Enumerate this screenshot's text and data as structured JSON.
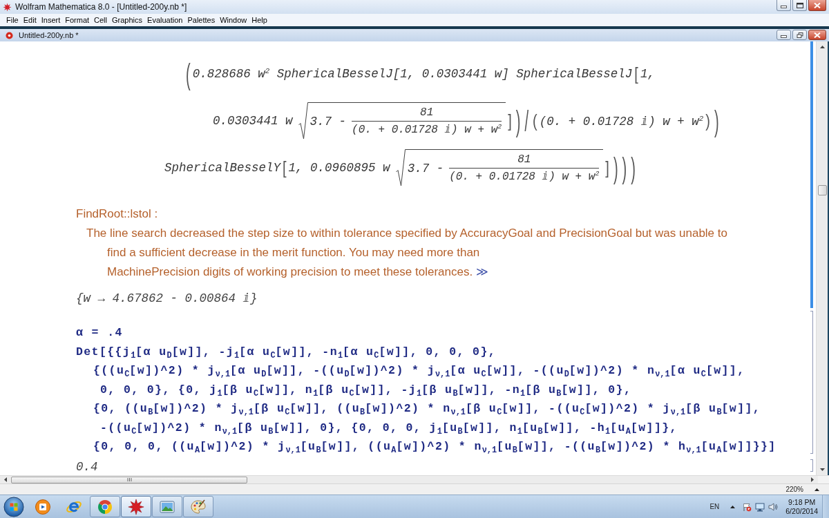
{
  "app_window": {
    "title": "Wolfram Mathematica 8.0 - [Untitled-200y.nb *]"
  },
  "menu": [
    "File",
    "Edit",
    "Insert",
    "Format",
    "Cell",
    "Graphics",
    "Evaluation",
    "Palettes",
    "Window",
    "Help"
  ],
  "notebook_window": {
    "title": "Untitled-200y.nb *"
  },
  "cells": [
    {
      "kind": "math",
      "selected": true,
      "lines": [
        {
          "parts": [
            {
              "kind": "tall_delim",
              "text": "("
            },
            {
              "kind": "text",
              "text": "0.828686 w$^{2}$ SphericalBesselJ[1, 0.0303441 w] SphericalBesselJ"
            },
            {
              "kind": "delim",
              "text": "["
            },
            {
              "kind": "text",
              "text": "1,"
            }
          ]
        },
        {
          "parts": [
            {
              "kind": "text",
              "text": "0.0303441 w"
            },
            {
              "kind": "radical",
              "lead": "3.7 -",
              "numerator": "81",
              "denominator": "(0. + 0.01728 ⅈ) w + w$^{2}$"
            },
            {
              "kind": "delim",
              "text": "]"
            },
            {
              "kind": "tall_delim",
              "text": ")"
            },
            {
              "kind": "tall_delim",
              "text": "/"
            },
            {
              "kind": "delim",
              "text": "("
            },
            {
              "kind": "text",
              "text": "(0. + 0.01728 ⅈ) w + w$^{2}$"
            },
            {
              "kind": "delim",
              "text": ")"
            },
            {
              "kind": "tall_delim",
              "text": ")"
            }
          ]
        },
        {
          "parts": [
            {
              "kind": "text",
              "text": "SphericalBesselY"
            },
            {
              "kind": "delim",
              "text": "["
            },
            {
              "kind": "text",
              "text": "1, 0.0960895 w"
            },
            {
              "kind": "radical",
              "lead": "3.7 -",
              "numerator": "81",
              "denominator": "(0. + 0.01728 ⅈ) w + w$^{2}$"
            },
            {
              "kind": "delim",
              "text": "]"
            },
            {
              "kind": "tall_delim",
              "text": ")"
            },
            {
              "kind": "tall_delim",
              "text": ")"
            },
            {
              "kind": "tall_delim",
              "text": ")"
            }
          ]
        }
      ]
    },
    {
      "kind": "message",
      "selected": true,
      "name": "FindRoot::lstol :",
      "text": "The line search decreased the step size to within tolerance specified by AccuracyGoal and PrecisionGoal but was unable to\nfind a sufficient decrease in the merit function. You may need more than\nMachinePrecision digits of working precision to meet these tolerances.",
      "link": "≫"
    },
    {
      "kind": "output",
      "selected": true,
      "text": "{w → 4.67862 - 0.00864 ⅈ}"
    },
    {
      "kind": "input",
      "selected": false,
      "lines": [
        [
          {
            "text": "α = .4"
          }
        ],
        [
          {
            "text": "Det[{{j",
            "sub": "1"
          },
          {
            "text": "[α u",
            "sub": "D"
          },
          {
            "text": "[w]], -j",
            "sub": "1"
          },
          {
            "text": "[α u",
            "sub": "C"
          },
          {
            "text": "[w]], -n",
            "sub": "1"
          },
          {
            "text": "[α u",
            "sub": "C"
          },
          {
            "text": "[w]], 0, 0, 0},"
          }
        ],
        [
          {
            "text": "{((u",
            "sub": "C"
          },
          {
            "text": "[w])^2) * j",
            "sub": "ν,1"
          },
          {
            "text": "[α u",
            "sub": "D"
          },
          {
            "text": "[w]], -((u",
            "sub": "D"
          },
          {
            "text": "[w])^2) * j",
            "sub": "ν,1"
          },
          {
            "text": "[α u",
            "sub": "C"
          },
          {
            "text": "[w]], -((u",
            "sub": "D"
          },
          {
            "text": "[w])^2) * n",
            "sub": "ν,1"
          },
          {
            "text": "[α u",
            "sub": "C"
          },
          {
            "text": "[w]],"
          }
        ],
        [
          {
            "text": "0, 0, 0}, {0, j",
            "sub": "1"
          },
          {
            "text": "[β u",
            "sub": "C"
          },
          {
            "text": "[w]], n",
            "sub": "1"
          },
          {
            "text": "[β u",
            "sub": "C"
          },
          {
            "text": "[w]], -j",
            "sub": "1"
          },
          {
            "text": "[β u",
            "sub": "B"
          },
          {
            "text": "[w]], -n",
            "sub": "1"
          },
          {
            "text": "[β u",
            "sub": "B"
          },
          {
            "text": "[w]], 0},"
          }
        ],
        [
          {
            "text": "{0, ((u",
            "sub": "B"
          },
          {
            "text": "[w])^2) * j",
            "sub": "ν,1"
          },
          {
            "text": "[β u",
            "sub": "C"
          },
          {
            "text": "[w]], ((u",
            "sub": "B"
          },
          {
            "text": "[w])^2) * n",
            "sub": "ν,1"
          },
          {
            "text": "[β u",
            "sub": "C"
          },
          {
            "text": "[w]], -((u",
            "sub": "C"
          },
          {
            "text": "[w])^2) * j",
            "sub": "ν,1"
          },
          {
            "text": "[β u",
            "sub": "B"
          },
          {
            "text": "[w]],"
          }
        ],
        [
          {
            "text": "-((u",
            "sub": "C"
          },
          {
            "text": "[w])^2) * n",
            "sub": "ν,1"
          },
          {
            "text": "[β u",
            "sub": "B"
          },
          {
            "text": "[w]], 0}, {0, 0, 0, j",
            "sub": "1"
          },
          {
            "text": "[u",
            "sub": "B"
          },
          {
            "text": "[w]], n",
            "sub": "1"
          },
          {
            "text": "[u",
            "sub": "B"
          },
          {
            "text": "[w]], -h",
            "sub": "1"
          },
          {
            "text": "[u",
            "sub": "A"
          },
          {
            "text": "[w]]},"
          }
        ],
        [
          {
            "text": "{0, 0, 0, ((u",
            "sub": "A"
          },
          {
            "text": "[w])^2) * j",
            "sub": "ν,1"
          },
          {
            "text": "[u",
            "sub": "B"
          },
          {
            "text": "[w]], ((u",
            "sub": "A"
          },
          {
            "text": "[w])^2) * n",
            "sub": "ν,1"
          },
          {
            "text": "[u",
            "sub": "B"
          },
          {
            "text": "[w]], -((u",
            "sub": "B"
          },
          {
            "text": "[w])^2) * h",
            "sub": "ν,1"
          },
          {
            "text": "[u",
            "sub": "A"
          },
          {
            "text": "[w]]}}]"
          }
        ]
      ]
    },
    {
      "kind": "output",
      "selected": false,
      "text": "0.4"
    }
  ],
  "status_bar": {
    "zoom": "220%"
  },
  "taskbar": {
    "items": [
      {
        "kind": "player",
        "running": false,
        "selected": false
      },
      {
        "kind": "e_logo",
        "running": false,
        "selected": false
      },
      {
        "kind": "round_logo",
        "running": true,
        "selected": false
      },
      {
        "kind": "star",
        "running": true,
        "selected": true
      },
      {
        "kind": "picture",
        "running": true,
        "selected": false
      },
      {
        "kind": "palette",
        "running": true,
        "selected": false
      }
    ],
    "language": "EN",
    "time": "9:18 PM",
    "date": "6/20/2014"
  }
}
